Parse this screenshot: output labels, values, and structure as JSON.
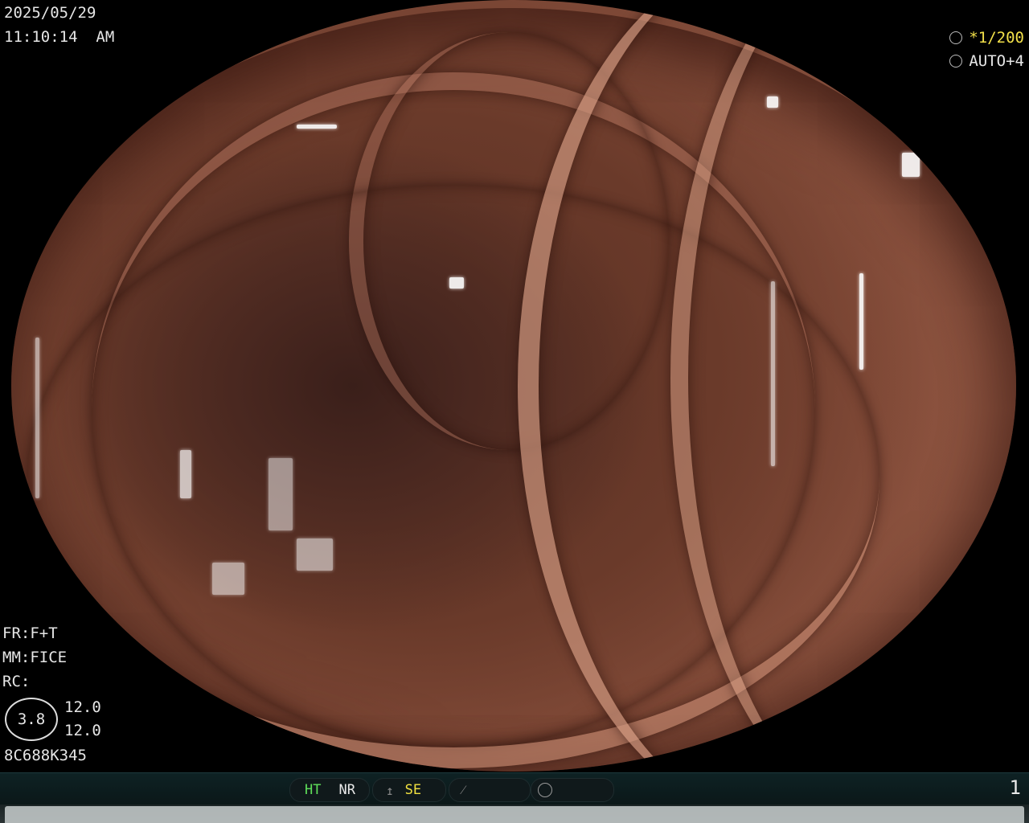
{
  "header": {
    "date": "2025/05/29",
    "time": "11:10:14  AM"
  },
  "settings_top_right": {
    "shutter_label": "≆1/200",
    "shutter_text": "*1/200",
    "iris_label": "AUTO+4",
    "shutter_color": "#f2e04a",
    "shutter_icon": "shutter-icon",
    "iris_icon": "iris-icon"
  },
  "settings_bottom_left": {
    "fr": "FR:F+T",
    "mm": "MM:FICE",
    "rc": "RC:",
    "oval_value": "3.8",
    "value1": "12.0",
    "value2": "12.0",
    "serial": "8C688K345"
  },
  "status_bar": {
    "ht": "HT",
    "nr": "NR",
    "se": "SE",
    "ht_color": "#5fe05a",
    "se_color": "#f0e040",
    "page_number": "1",
    "icons": [
      "tone-curve-icon",
      "enhancement-icon",
      "mode-circle-icon"
    ]
  }
}
